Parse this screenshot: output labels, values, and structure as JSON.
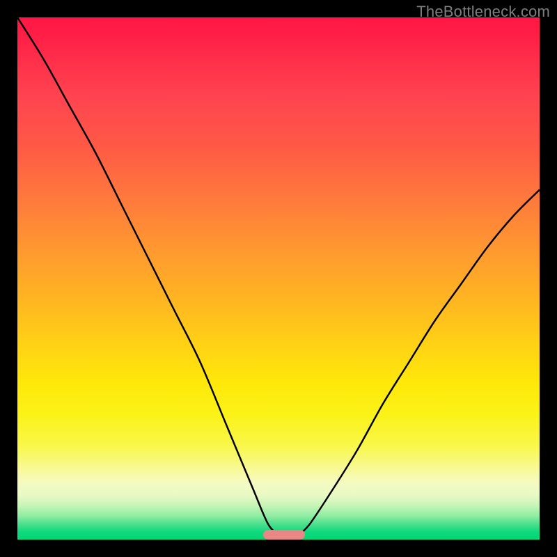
{
  "watermark": "TheBottleneck.com",
  "chart_data": {
    "type": "line",
    "title": "",
    "xlabel": "",
    "ylabel": "",
    "xlim": [
      0,
      100
    ],
    "ylim": [
      0,
      100
    ],
    "grid": false,
    "legend": false,
    "series": [
      {
        "name": "left-curve",
        "x": [
          0,
          5,
          10,
          15,
          20,
          25,
          30,
          35,
          40,
          45,
          48,
          50
        ],
        "values": [
          100,
          92,
          83,
          74,
          64,
          54,
          44,
          34,
          22,
          10,
          3,
          1
        ]
      },
      {
        "name": "right-curve",
        "x": [
          54,
          56,
          60,
          65,
          70,
          75,
          80,
          85,
          90,
          95,
          100
        ],
        "values": [
          1,
          3,
          9,
          17,
          26,
          34,
          42,
          49,
          56,
          62,
          67
        ]
      }
    ],
    "marker": {
      "name": "valley-pill",
      "x_range": [
        47,
        55
      ],
      "y": 1,
      "color": "#e98787"
    },
    "background_gradient": {
      "direction": "vertical",
      "stops": [
        {
          "pos": 0,
          "color": "#ff1744"
        },
        {
          "pos": 25,
          "color": "#ff5a45"
        },
        {
          "pos": 50,
          "color": "#ffb820"
        },
        {
          "pos": 75,
          "color": "#f9f74a"
        },
        {
          "pos": 92,
          "color": "#c6f5b7"
        },
        {
          "pos": 100,
          "color": "#00d774"
        }
      ]
    }
  }
}
